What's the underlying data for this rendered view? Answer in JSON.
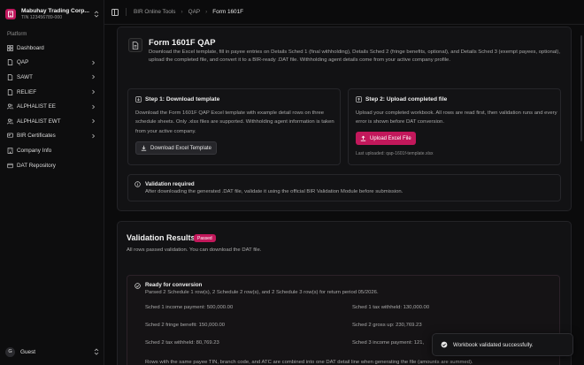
{
  "sidebar": {
    "company_name": "Mabuhay Trading Corp...",
    "company_tin": "TIN 123456789-000",
    "section_label": "Platform",
    "items": [
      {
        "label": "Dashboard",
        "icon": "dashboard-icon",
        "has_chevron": false
      },
      {
        "label": "QAP",
        "icon": "document-icon",
        "has_chevron": true
      },
      {
        "label": "SAWT",
        "icon": "document-icon",
        "has_chevron": true
      },
      {
        "label": "RELIEF",
        "icon": "document-icon",
        "has_chevron": true
      },
      {
        "label": "ALPHALIST EE",
        "icon": "users-icon",
        "has_chevron": true
      },
      {
        "label": "ALPHALIST EWT",
        "icon": "users-icon",
        "has_chevron": true
      },
      {
        "label": "BIR Certificates",
        "icon": "certificate-icon",
        "has_chevron": true
      },
      {
        "label": "Company Info",
        "icon": "building-icon",
        "has_chevron": false
      },
      {
        "label": "DAT Repository",
        "icon": "database-icon",
        "has_chevron": false
      }
    ],
    "user_initial": "G",
    "user_name": "Guest"
  },
  "breadcrumb": [
    "BIR Online Tools",
    "QAP",
    "Form 1601F"
  ],
  "form": {
    "title": "Form 1601F QAP",
    "description": "Download the Excel template, fill in payee entries on Details Sched 1 (final withholding), Details Sched 2 (fringe benefits, optional), and Details Sched 3 (exempt payees, optional), upload the completed file, and convert it to a BIR-ready .DAT file. Withholding agent details come from your active company profile.",
    "step1": {
      "title": "Step 1: Download template",
      "description": "Download the Form 1601F QAP Excel template with example detail rows on three schedule sheets. Only .xlsx files are supported. Withholding agent information is taken from your active company.",
      "button": "Download Excel Template"
    },
    "step2": {
      "title": "Step 2: Upload completed file",
      "description": "Upload your completed workbook. All rows are read first, then validation runs and every error is shown before DAT conversion.",
      "button": "Upload Excel File",
      "last_uploaded": "Last uploaded: qap-1601f-template.xlsx"
    },
    "validation_required": {
      "title": "Validation required",
      "description": "After downloading the generated .DAT file, validate it using the official BIR Validation Module before submission."
    }
  },
  "results": {
    "title": "Validation Results",
    "badge": "Passed",
    "description": "All rows passed validation. You can download the DAT file.",
    "ready_title": "Ready for conversion",
    "ready_sub": "Parsed 2 Schedule 1 row(s), 2 Schedule 2 row(s), and 2 Schedule 3 row(s) for return period 05/2026.",
    "stats": [
      "Sched 1 income payment: 500,000.00",
      "Sched 1 tax withheld: 130,000.00",
      "Sched 2 fringe benefit: 150,000.00",
      "Sched 2 gross up: 230,769.23",
      "Sched 2 tax withheld: 80,769.23",
      "Sched 3 income payment: 121,"
    ],
    "footnote": "Rows with the same payee TIN, branch code, and ATC are combined into one DAT detail line when generating the file (amounts are summed)."
  },
  "toast": "Workbook validated successfully.",
  "colors": {
    "accent": "#c2185b",
    "background": "#0b0b0c",
    "card": "#121214"
  }
}
